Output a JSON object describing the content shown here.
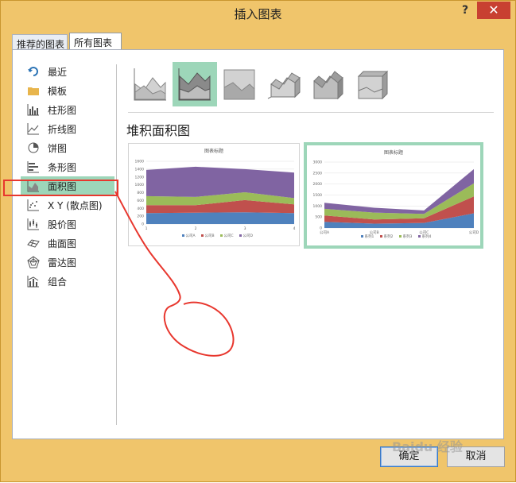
{
  "window": {
    "title": "插入图表",
    "help": "?",
    "close": "✕"
  },
  "tabs": [
    {
      "label": "推荐的图表"
    },
    {
      "label": "所有图表"
    }
  ],
  "sidebar": {
    "items": [
      {
        "label": "最近",
        "icon": "undo-icon"
      },
      {
        "label": "模板",
        "icon": "folder-icon"
      },
      {
        "label": "柱形图",
        "icon": "column-chart-icon"
      },
      {
        "label": "折线图",
        "icon": "line-chart-icon"
      },
      {
        "label": "饼图",
        "icon": "pie-chart-icon"
      },
      {
        "label": "条形图",
        "icon": "bar-chart-icon"
      },
      {
        "label": "面积图",
        "icon": "area-chart-icon"
      },
      {
        "label": "X Y (散点图)",
        "icon": "scatter-chart-icon"
      },
      {
        "label": "股价图",
        "icon": "stock-chart-icon"
      },
      {
        "label": "曲面图",
        "icon": "surface-chart-icon"
      },
      {
        "label": "雷达图",
        "icon": "radar-chart-icon"
      },
      {
        "label": "组合",
        "icon": "combo-chart-icon"
      }
    ]
  },
  "subtypes": [
    "area",
    "stacked-area",
    "100-stacked-area",
    "3d-area",
    "3d-stacked-area",
    "3d-100-stacked-area"
  ],
  "main": {
    "chart_type_title": "堆积面积图"
  },
  "colors": {
    "blue": "#4f81bd",
    "red": "#c0504d",
    "green": "#9bbb59",
    "purple": "#8064a2",
    "selection": "#9dd6b9",
    "annotation": "#e8372e"
  },
  "chart_data": [
    {
      "type": "area",
      "stacked": true,
      "title": "图表标题",
      "categories": [
        "1",
        "2",
        "3",
        "4"
      ],
      "ylim": [
        0,
        1600
      ],
      "yticks": [
        "0",
        "200",
        "400",
        "600",
        "800",
        "1000",
        "1200",
        "1400",
        "1600"
      ],
      "series": [
        {
          "name": "公司A",
          "values": [
            280,
            290,
            300,
            280
          ]
        },
        {
          "name": "公司B",
          "values": [
            200,
            190,
            310,
            220
          ]
        },
        {
          "name": "公司C",
          "values": [
            230,
            210,
            200,
            160
          ]
        },
        {
          "name": "公司D",
          "values": [
            670,
            770,
            590,
            650
          ]
        }
      ],
      "legend": "bottom"
    },
    {
      "type": "area",
      "stacked": true,
      "title": "图表标题",
      "categories": [
        "公司A",
        "公司B",
        "公司C",
        "公司D"
      ],
      "ylim": [
        0,
        3000
      ],
      "yticks": [
        "0",
        "500",
        "1000",
        "1500",
        "2000",
        "2500",
        "3000"
      ],
      "series": [
        {
          "name": "系列1",
          "values": [
            280,
            200,
            230,
            670
          ]
        },
        {
          "name": "系列2",
          "values": [
            290,
            190,
            210,
            770
          ]
        },
        {
          "name": "系列3",
          "values": [
            300,
            310,
            200,
            590
          ]
        },
        {
          "name": "系列4",
          "values": [
            280,
            220,
            160,
            650
          ]
        }
      ],
      "legend": "bottom"
    }
  ],
  "buttons": {
    "ok": "确定",
    "cancel": "取消"
  },
  "watermark": "Baidu 经验"
}
